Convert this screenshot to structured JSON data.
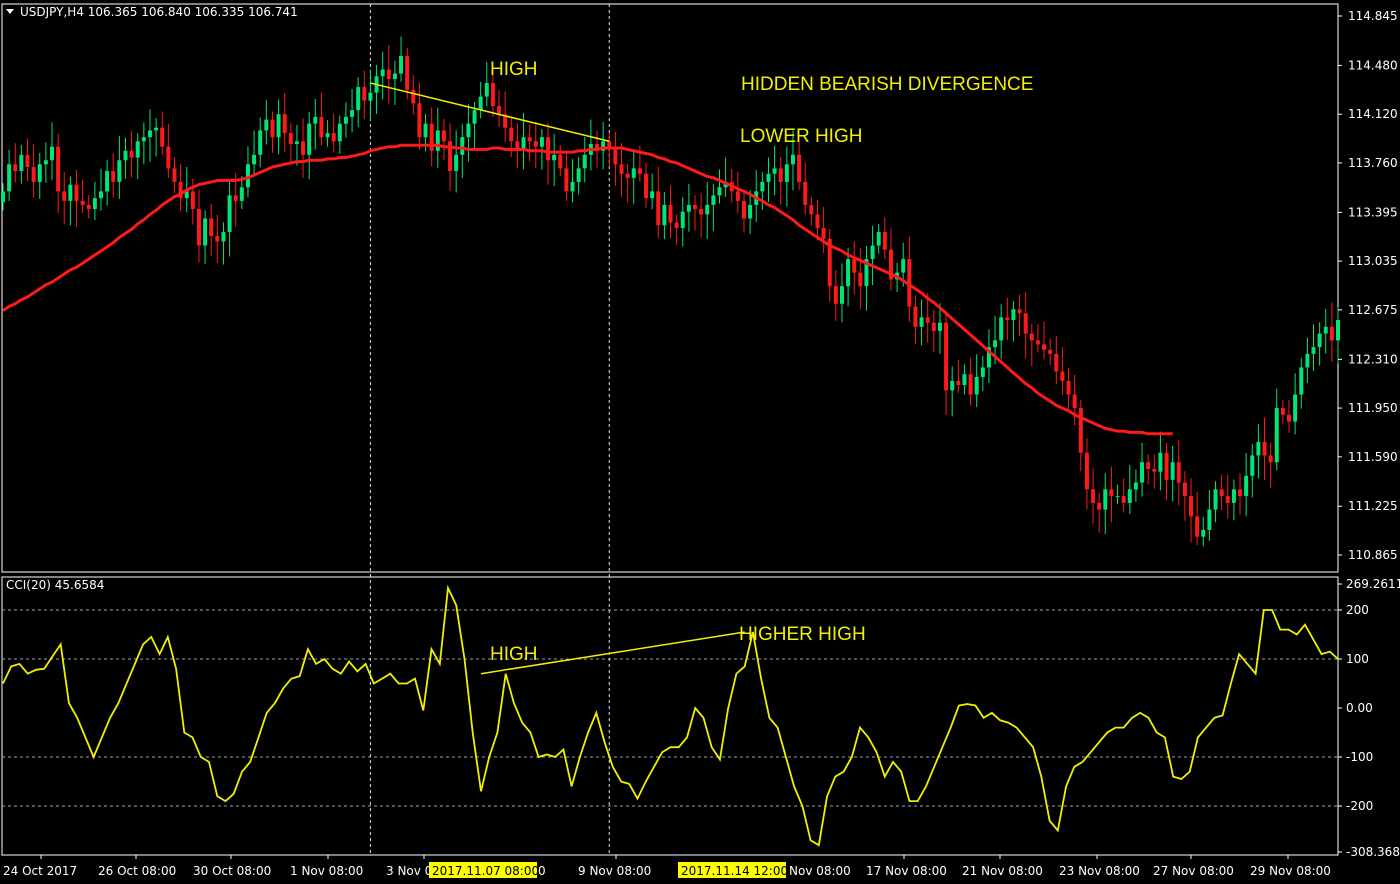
{
  "header": {
    "symbol_info": "USDJPY,H4  106.365 106.840 106.335 106.741",
    "indicator_info": "CCI(20) 45.6584"
  },
  "annotations": {
    "price_high": "HIGH",
    "price_title": "HIDDEN BEARISH DIVERGENCE",
    "price_lower_high": "LOWER HIGH",
    "cci_high": "HIGH",
    "cci_higher_high": "HIGHER HIGH"
  },
  "colors": {
    "background": "#000000",
    "bull_candle": "#00e676",
    "bear_candle": "#ff1a1a",
    "moving_average": "#ff1a1a",
    "cci_line": "#f0f000",
    "annotation": "#f0f000",
    "grid": "#c8c8c8",
    "axis_text": "#ffffff"
  },
  "chart_data": [
    {
      "type": "candlestick",
      "symbol": "USDJPY",
      "timeframe": "H4",
      "y_ticks": [
        "114.845",
        "114.480",
        "114.120",
        "113.760",
        "113.395",
        "113.035",
        "112.675",
        "112.310",
        "111.950",
        "111.590",
        "111.225",
        "110.865"
      ],
      "ylim": [
        110.75,
        114.97
      ],
      "close": [
        113.55,
        113.75,
        113.7,
        113.82,
        113.73,
        113.62,
        113.75,
        113.78,
        113.88,
        113.55,
        113.48,
        113.6,
        113.48,
        113.45,
        113.42,
        113.5,
        113.55,
        113.7,
        113.62,
        113.78,
        113.85,
        113.8,
        113.92,
        113.95,
        114.0,
        114.02,
        113.88,
        113.72,
        113.62,
        113.5,
        113.55,
        113.42,
        113.15,
        113.35,
        113.22,
        113.18,
        113.25,
        113.52,
        113.48,
        113.58,
        113.75,
        113.82,
        114.0,
        114.08,
        113.95,
        114.12,
        113.98,
        113.9,
        113.92,
        113.82,
        114.05,
        114.1,
        113.95,
        113.98,
        113.92,
        114.05,
        114.1,
        114.15,
        114.32,
        114.22,
        114.28,
        114.4,
        114.45,
        114.38,
        114.42,
        114.55,
        114.3,
        114.2,
        113.95,
        114.05,
        113.85,
        114.0,
        113.92,
        113.7,
        113.82,
        113.95,
        114.05,
        114.15,
        114.25,
        114.35,
        114.18,
        114.12,
        114.02,
        113.92,
        113.85,
        113.95,
        113.92,
        113.88,
        113.95,
        113.78,
        113.82,
        113.72,
        113.55,
        113.62,
        113.72,
        113.82,
        113.9,
        113.85,
        113.92,
        113.88,
        113.75,
        113.68,
        113.65,
        113.72,
        113.68,
        113.5,
        113.55,
        113.3,
        113.45,
        113.32,
        113.28,
        113.4,
        113.45,
        113.42,
        113.38,
        113.45,
        113.52,
        113.58,
        113.62,
        113.55,
        113.48,
        113.35,
        113.45,
        113.55,
        113.62,
        113.68,
        113.72,
        113.62,
        113.75,
        113.82,
        113.62,
        113.45,
        113.38,
        113.28,
        113.2,
        112.85,
        112.72,
        112.85,
        113.05,
        112.95,
        112.85,
        113.05,
        113.15,
        113.25,
        113.12,
        112.9,
        112.95,
        113.05,
        112.7,
        112.55,
        112.62,
        112.58,
        112.52,
        112.58,
        112.08,
        112.15,
        112.12,
        112.2,
        112.05,
        112.18,
        112.25,
        112.4,
        112.45,
        112.62,
        112.6,
        112.68,
        112.65,
        112.5,
        112.45,
        112.42,
        112.38,
        112.35,
        112.22,
        112.15,
        112.05,
        111.95,
        111.62,
        111.35,
        111.25,
        111.2,
        111.35,
        111.3,
        111.3,
        111.25,
        111.35,
        111.4,
        111.55,
        111.5,
        111.48,
        111.62,
        111.42,
        111.55,
        111.4,
        111.3,
        111.15,
        111.0,
        111.05,
        111.2,
        111.35,
        111.3,
        111.25,
        111.35,
        111.3,
        111.45,
        111.6,
        111.7,
        111.6,
        111.55,
        111.95,
        111.9,
        111.85,
        112.05,
        112.25,
        112.35,
        112.4,
        112.5,
        112.55,
        112.45,
        112.6
      ],
      "ma": [
        112.67,
        112.7,
        112.72,
        112.75,
        112.77,
        112.8,
        112.83,
        112.86,
        112.88,
        112.91,
        112.94,
        112.97,
        112.99,
        113.02,
        113.05,
        113.08,
        113.11,
        113.14,
        113.17,
        113.21,
        113.24,
        113.27,
        113.31,
        113.34,
        113.38,
        113.41,
        113.45,
        113.48,
        113.51,
        113.53,
        113.56,
        113.58,
        113.6,
        113.61,
        113.62,
        113.63,
        113.63,
        113.63,
        113.63,
        113.64,
        113.65,
        113.67,
        113.69,
        113.71,
        113.73,
        113.74,
        113.75,
        113.76,
        113.77,
        113.77,
        113.78,
        113.78,
        113.78,
        113.79,
        113.79,
        113.8,
        113.8,
        113.81,
        113.82,
        113.83,
        113.85,
        113.86,
        113.87,
        113.88,
        113.88,
        113.89,
        113.89,
        113.89,
        113.89,
        113.89,
        113.89,
        113.89,
        113.88,
        113.88,
        113.87,
        113.87,
        113.86,
        113.86,
        113.86,
        113.86,
        113.87,
        113.87,
        113.86,
        113.86,
        113.86,
        113.86,
        113.85,
        113.85,
        113.85,
        113.84,
        113.84,
        113.84,
        113.84,
        113.84,
        113.85,
        113.85,
        113.86,
        113.86,
        113.87,
        113.87,
        113.87,
        113.87,
        113.86,
        113.85,
        113.84,
        113.83,
        113.82,
        113.8,
        113.79,
        113.77,
        113.76,
        113.74,
        113.72,
        113.7,
        113.68,
        113.66,
        113.65,
        113.63,
        113.61,
        113.59,
        113.57,
        113.55,
        113.53,
        113.5,
        113.48,
        113.45,
        113.43,
        113.4,
        113.37,
        113.34,
        113.3,
        113.27,
        113.24,
        113.21,
        113.18,
        113.15,
        113.13,
        113.11,
        113.08,
        113.06,
        113.04,
        113.02,
        113.0,
        112.98,
        112.96,
        112.94,
        112.92,
        112.89,
        112.86,
        112.83,
        112.8,
        112.76,
        112.73,
        112.69,
        112.65,
        112.61,
        112.57,
        112.53,
        112.49,
        112.45,
        112.41,
        112.37,
        112.33,
        112.29,
        112.25,
        112.21,
        112.17,
        112.13,
        112.1,
        112.06,
        112.03,
        112.0,
        111.97,
        111.95,
        111.93,
        111.9,
        111.88,
        111.86,
        111.84,
        111.82,
        111.8,
        111.79,
        111.78,
        111.78,
        111.77,
        111.77,
        111.77,
        111.76,
        111.76,
        111.76,
        111.76,
        111.76
      ],
      "price_trendline": [
        {
          "bar": 60,
          "price": 114.35
        },
        {
          "bar": 99,
          "price": 113.92
        }
      ],
      "x_labels": [
        "24 Oct 2017",
        "26 Oct 08:00",
        "30 Oct 08:00",
        "1 Nov 08:00",
        "3 Nov 0",
        "9 Nov 08:00",
        "17 Nov 08:00",
        "21 Nov 08:00",
        "23 Nov 08:00",
        "27 Nov 08:00",
        "29 Nov 08:00"
      ],
      "highlighted_times": [
        "2017.11.07 08:00",
        "2017.11.14 12:00"
      ]
    },
    {
      "type": "line",
      "name": "CCI(20)",
      "current_value": 45.6584,
      "y_ticks": [
        "269.2611",
        "200",
        "100",
        "0.00",
        "-100",
        "-200",
        "-308.368"
      ],
      "ylim": [
        -308.368,
        269.2611
      ],
      "values": [
        50,
        85,
        90,
        70,
        78,
        80,
        105,
        130,
        10,
        -20,
        -60,
        -100,
        -60,
        -20,
        10,
        50,
        90,
        130,
        145,
        110,
        145,
        80,
        -50,
        -60,
        -100,
        -110,
        -180,
        -190,
        -175,
        -130,
        -110,
        -60,
        -10,
        10,
        40,
        60,
        65,
        120,
        90,
        100,
        80,
        70,
        95,
        75,
        90,
        50,
        60,
        70,
        50,
        50,
        60,
        -5,
        120,
        90,
        245,
        210,
        100,
        -50,
        -170,
        -100,
        -50,
        70,
        10,
        -30,
        -50,
        -100,
        -95,
        -100,
        -85,
        -160,
        -100,
        -50,
        -10,
        -70,
        -120,
        -150,
        -155,
        -185,
        -150,
        -120,
        -90,
        -80,
        -80,
        -60,
        0,
        -20,
        -80,
        -105,
        0,
        70,
        85,
        155,
        60,
        -20,
        -40,
        -100,
        -160,
        -200,
        -270,
        -280,
        -180,
        -140,
        -130,
        -100,
        -40,
        -60,
        -90,
        -140,
        -110,
        -130,
        -190,
        -190,
        -160,
        -120,
        -80,
        -40,
        5,
        8,
        5,
        -20,
        -10,
        -25,
        -30,
        -40,
        -60,
        -80,
        -140,
        -230,
        -250,
        -160,
        -120,
        -110,
        -90,
        -70,
        -50,
        -40,
        -40,
        -20,
        -10,
        -20,
        -50,
        -60,
        -140,
        -145,
        -130,
        -60,
        -40,
        -20,
        -15,
        50,
        110,
        90,
        70,
        200,
        200,
        160,
        160,
        150,
        170,
        140,
        110,
        115,
        100
      ]
    }
  ]
}
